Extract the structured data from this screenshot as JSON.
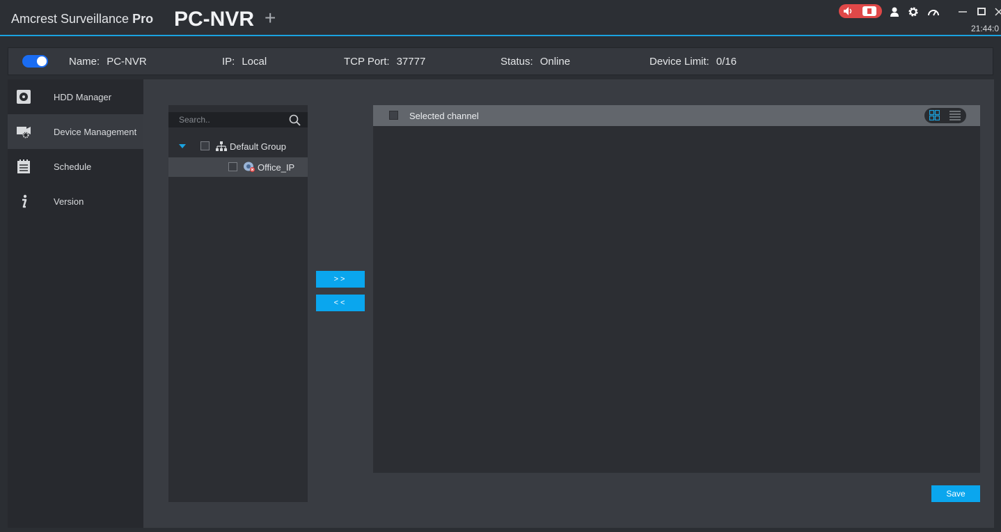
{
  "titlebar": {
    "brand_main": "Amcrest Surveillance ",
    "brand_bold": "Pro",
    "tab_title": "PC-NVR",
    "add_tab": "+",
    "time": "21:44:0"
  },
  "device": {
    "enabled": true,
    "name_label": "Name:",
    "name_value": "PC-NVR",
    "ip_label": "IP:",
    "ip_value": "Local",
    "port_label": "TCP Port:",
    "port_value": "37777",
    "status_label": "Status:",
    "status_value": "Online",
    "limit_label": "Device Limit:",
    "limit_value": "0/16"
  },
  "sidebar": {
    "items": [
      {
        "label": "HDD Manager",
        "icon": "hdd-icon"
      },
      {
        "label": "Device Management",
        "icon": "device-management-icon",
        "active": true
      },
      {
        "label": "Schedule",
        "icon": "schedule-icon"
      },
      {
        "label": "Version",
        "icon": "info-icon"
      }
    ]
  },
  "tree": {
    "search_placeholder": "Search..",
    "group": "Default Group",
    "device": "Office_IP"
  },
  "buttons": {
    "add": ">>",
    "remove": "<<",
    "save": "Save"
  },
  "channels": {
    "header_label": "Selected channel"
  },
  "colors": {
    "accent": "#0aa6ee",
    "toggle": "#1a6cf2",
    "alarm": "#e04848"
  }
}
